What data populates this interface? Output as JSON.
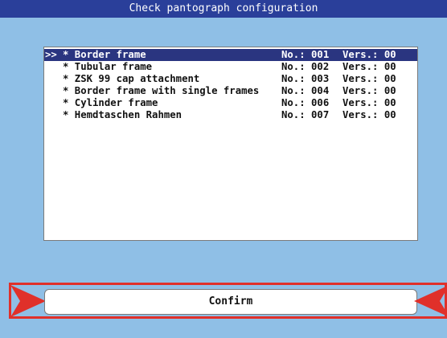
{
  "window": {
    "title": "Check pantograph configuration"
  },
  "frames": [
    {
      "marker": ">>",
      "name": "* Border frame",
      "no": "No.: 001",
      "version": "Vers.: 00",
      "selected": true
    },
    {
      "marker": "",
      "name": "* Tubular frame",
      "no": "No.: 002",
      "version": "Vers.: 00",
      "selected": false
    },
    {
      "marker": "",
      "name": "* ZSK 99 cap attachment",
      "no": "No.: 003",
      "version": "Vers.: 00",
      "selected": false
    },
    {
      "marker": "",
      "name": "* Border frame with single frames",
      "no": "No.: 004",
      "version": "Vers.: 00",
      "selected": false
    },
    {
      "marker": "",
      "name": "* Cylinder frame",
      "no": "No.: 006",
      "version": "Vers.: 00",
      "selected": false
    },
    {
      "marker": "",
      "name": "* Hemdtaschen Rahmen",
      "no": "No.: 007",
      "version": "Vers.: 00",
      "selected": false
    }
  ],
  "confirm": {
    "label": "Confirm"
  },
  "icons": {
    "left": "arrow-right-icon",
    "right": "arrow-left-icon"
  },
  "colors": {
    "title_bar": "#2a3f9a",
    "selection": "#2a3580",
    "background": "#8fbfe6",
    "accent": "#e0302a"
  }
}
